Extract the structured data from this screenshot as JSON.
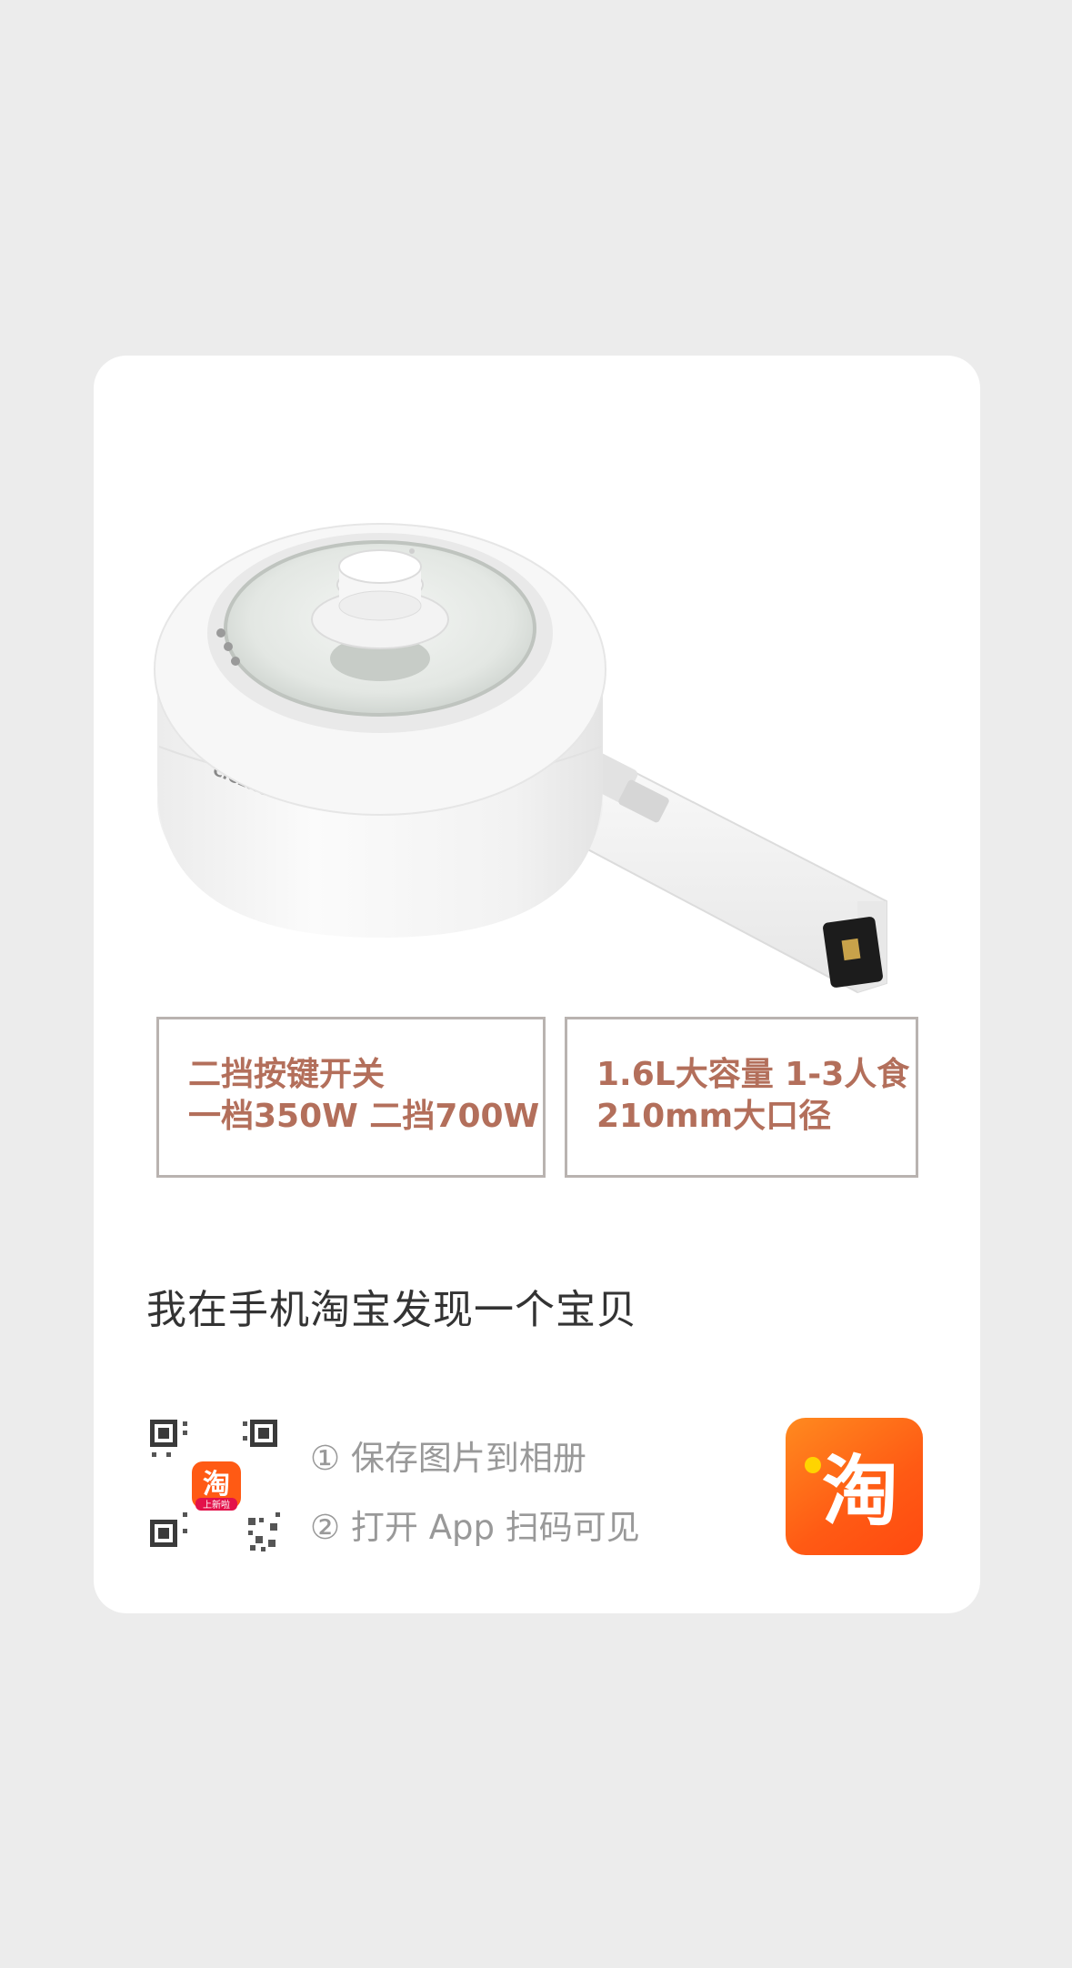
{
  "product": {
    "brand_text": "CICERO",
    "features": [
      {
        "lines": [
          "二挡按键开关",
          "一档350W  二挡700W"
        ]
      },
      {
        "lines": [
          "1.6L大容量 1-3人食",
          "210mm大口径"
        ]
      }
    ],
    "feature_color": "#b36f5b"
  },
  "share": {
    "text": "我在手机淘宝发现一个宝贝"
  },
  "qr": {
    "badge_char": "淘",
    "badge_label": "上新啦"
  },
  "steps": [
    {
      "label": "① 保存图片到相册"
    },
    {
      "label": "② 打开 App 扫码可见"
    }
  ],
  "app_icon": {
    "char": "淘",
    "color": "#ff5a14"
  }
}
